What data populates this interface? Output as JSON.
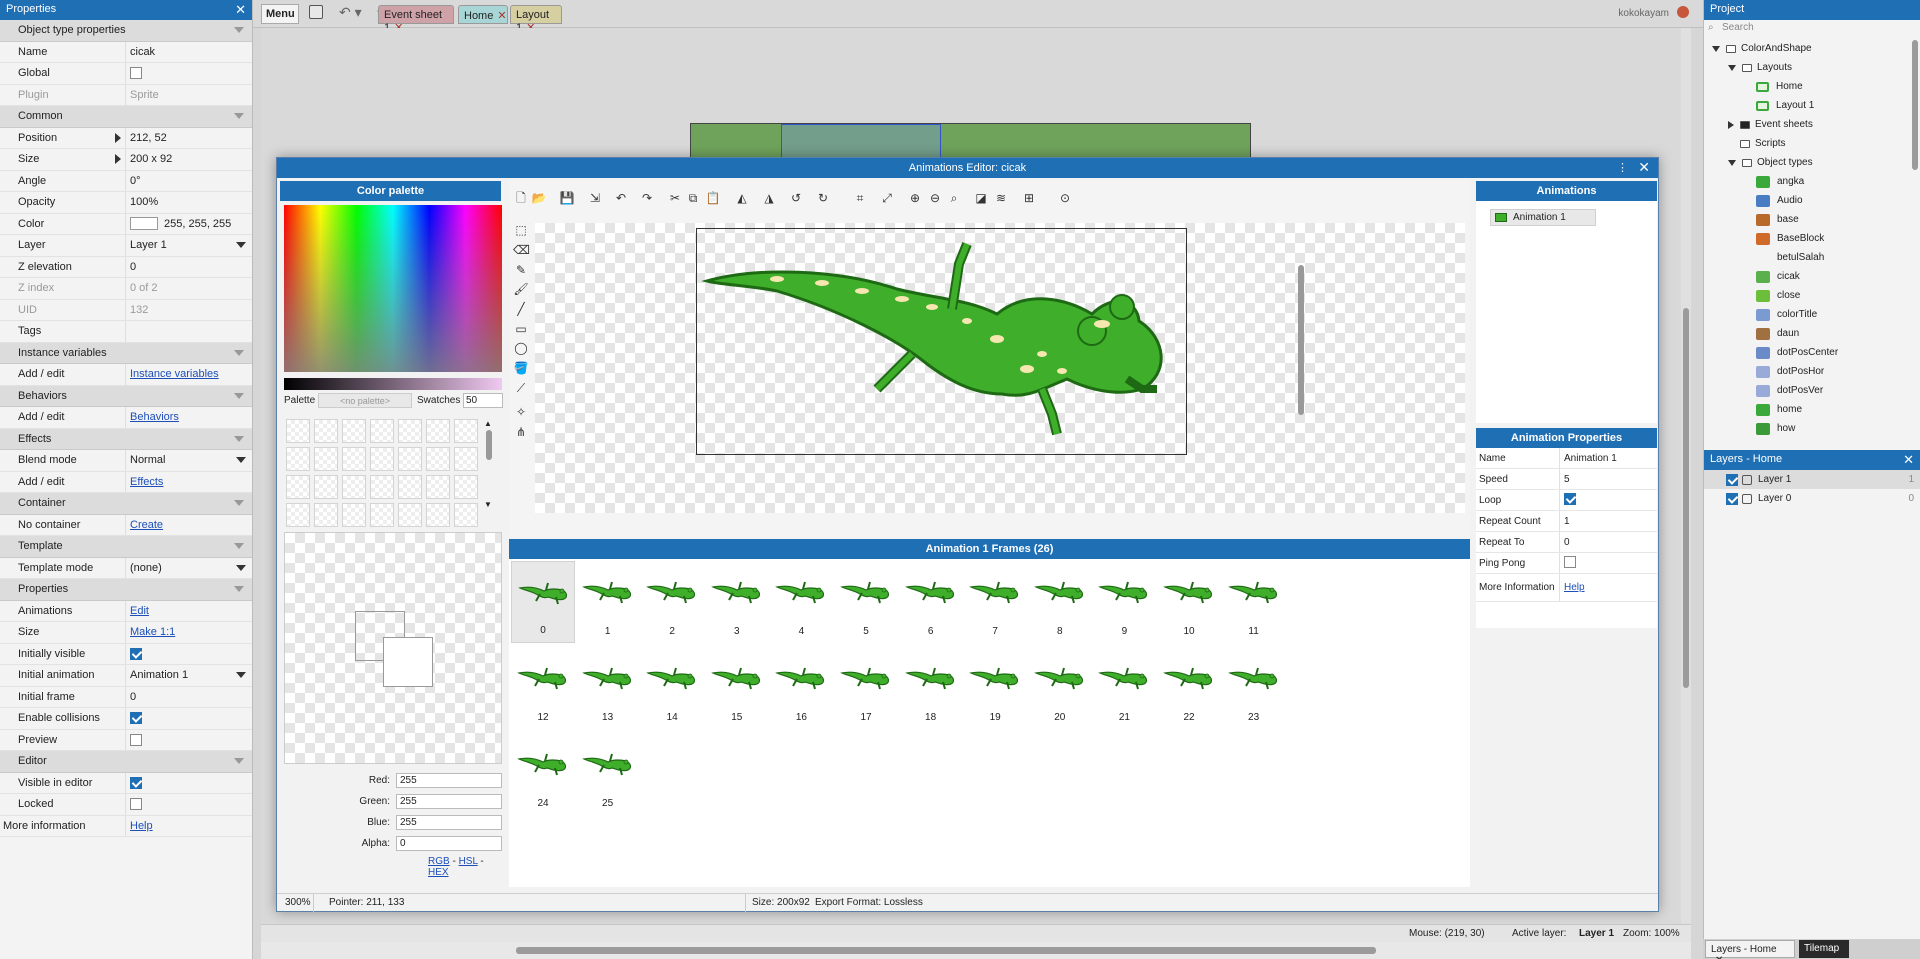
{
  "properties": {
    "title": "Properties",
    "rows": [
      {
        "type": "section",
        "k": "Object type properties"
      },
      {
        "k": "Name",
        "v": "cicak"
      },
      {
        "k": "Global",
        "cb": false
      },
      {
        "k": "Plugin",
        "v": "Sprite",
        "dis": true
      },
      {
        "type": "section",
        "k": "Common"
      },
      {
        "k": "Position",
        "v": "212, 52",
        "tri": true
      },
      {
        "k": "Size",
        "v": "200 x 92",
        "tri": true
      },
      {
        "k": "Angle",
        "v": "0°"
      },
      {
        "k": "Opacity",
        "v": "100%"
      },
      {
        "k": "Color",
        "v": "255, 255, 255",
        "swatch": true
      },
      {
        "k": "Layer",
        "v": "Layer 1",
        "dd": true
      },
      {
        "k": "Z elevation",
        "v": "0"
      },
      {
        "k": "Z index",
        "v": "0 of 2",
        "dis": true
      },
      {
        "k": "UID",
        "v": "132",
        "dis": true
      },
      {
        "k": "Tags",
        "v": ""
      },
      {
        "type": "section",
        "k": "Instance variables"
      },
      {
        "k": "Add / edit",
        "link": "Instance variables"
      },
      {
        "type": "section",
        "k": "Behaviors"
      },
      {
        "k": "Add / edit",
        "link": "Behaviors"
      },
      {
        "type": "section",
        "k": "Effects"
      },
      {
        "k": "Blend mode",
        "v": "Normal",
        "dd": true
      },
      {
        "k": "Add / edit",
        "link": "Effects"
      },
      {
        "type": "section",
        "k": "Container"
      },
      {
        "k": "No container",
        "link": "Create"
      },
      {
        "type": "section",
        "k": "Template"
      },
      {
        "k": "Template mode",
        "v": "(none)",
        "dd": true
      },
      {
        "type": "section",
        "k": "Properties"
      },
      {
        "k": "Animations",
        "link": "Edit"
      },
      {
        "k": "Size",
        "link": "Make 1:1"
      },
      {
        "k": "Initially visible",
        "cb": true
      },
      {
        "k": "Initial animation",
        "v": "Animation 1",
        "dd": true
      },
      {
        "k": "Initial frame",
        "v": "0"
      },
      {
        "k": "Enable collisions",
        "cb": true
      },
      {
        "k": "Preview",
        "cb": false
      },
      {
        "type": "section",
        "k": "Editor"
      },
      {
        "k": "Visible in editor",
        "cb": true
      },
      {
        "k": "Locked",
        "cb": false
      },
      {
        "k": "More information",
        "link": "Help",
        "noindent": true
      }
    ]
  },
  "topbar": {
    "menu": "Menu",
    "user": "kokokayam",
    "tabs": [
      {
        "label": "Event sheet 1",
        "color": "#cfa2a8"
      },
      {
        "label": "Home",
        "color": "#a8d6d6"
      },
      {
        "label": "Layout 1",
        "color": "#d6cfa2"
      }
    ]
  },
  "statusbar": {
    "mouse": "Mouse: (219, 30)",
    "active_layer_label": "Active layer:",
    "active_layer": "Layer 1",
    "zoom": "Zoom: 100%"
  },
  "project": {
    "title": "Project",
    "search_placeholder": "Search",
    "items": [
      {
        "label": "ColorAndShape",
        "kind": "folder",
        "level": 0,
        "tw": "down"
      },
      {
        "label": "Layouts",
        "kind": "folder",
        "level": 1,
        "tw": "down"
      },
      {
        "label": "Home",
        "kind": "layout",
        "level": 2
      },
      {
        "label": "Layout 1",
        "kind": "layout",
        "level": 2
      },
      {
        "label": "Event sheets",
        "kind": "folder-fill",
        "level": 1,
        "tw": "right"
      },
      {
        "label": "Scripts",
        "kind": "folder",
        "level": 1
      },
      {
        "label": "Object types",
        "kind": "folder",
        "level": 1,
        "tw": "down"
      },
      {
        "label": "angka",
        "kind": "obj",
        "color": "#3aa83a",
        "level": 2
      },
      {
        "label": "Audio",
        "kind": "obj",
        "color": "#4a7cc4",
        "level": 2
      },
      {
        "label": "base",
        "kind": "obj",
        "color": "#b86a2a",
        "level": 2
      },
      {
        "label": "BaseBlock",
        "kind": "obj",
        "color": "#d06a2a",
        "level": 2
      },
      {
        "label": "betulSalah",
        "kind": "obj",
        "color": "transparent",
        "level": 2
      },
      {
        "label": "cicak",
        "kind": "obj",
        "color": "#5ab04a",
        "level": 2
      },
      {
        "label": "close",
        "kind": "obj",
        "color": "#6cbf3a",
        "level": 2
      },
      {
        "label": "colorTitle",
        "kind": "obj",
        "color": "#7a9ad0",
        "level": 2
      },
      {
        "label": "daun",
        "kind": "obj",
        "color": "#a07040",
        "level": 2
      },
      {
        "label": "dotPosCenter",
        "kind": "obj",
        "color": "#6a8ac8",
        "level": 2
      },
      {
        "label": "dotPosHor",
        "kind": "obj",
        "color": "#9aaad8",
        "level": 2
      },
      {
        "label": "dotPosVer",
        "kind": "obj",
        "color": "#9aaad8",
        "level": 2
      },
      {
        "label": "home",
        "kind": "obj",
        "color": "#3aa83a",
        "level": 2
      },
      {
        "label": "how",
        "kind": "obj",
        "color": "#3a9a3a",
        "level": 2
      }
    ]
  },
  "layers": {
    "title": "Layers - Home",
    "items": [
      {
        "label": "Layer 1",
        "num": "1"
      },
      {
        "label": "Layer 0",
        "num": "0"
      }
    ]
  },
  "bottom_tabs": [
    "Layers - Home",
    "Tilemap"
  ],
  "dialog": {
    "title": "Animations Editor: cicak",
    "palette": {
      "title": "Color palette",
      "palette_label": "Palette",
      "palette_value": "<no palette>",
      "swatches_label": "Swatches",
      "swatches_value": "50",
      "red_label": "Red:",
      "red": "255",
      "green_label": "Green:",
      "green": "255",
      "blue_label": "Blue:",
      "blue": "255",
      "alpha_label": "Alpha:",
      "alpha": "0",
      "modes": [
        "RGB",
        "HSL",
        "HEX"
      ]
    },
    "frames_title": "Animation 1 Frames (26)",
    "frames": [
      "0",
      "1",
      "2",
      "3",
      "4",
      "5",
      "6",
      "7",
      "8",
      "9",
      "10",
      "11",
      "12",
      "13",
      "14",
      "15",
      "16",
      "17",
      "18",
      "19",
      "20",
      "21",
      "22",
      "23",
      "24",
      "25"
    ],
    "animations_title": "Animations",
    "animations": [
      "Animation 1"
    ],
    "anim_props_title": "Animation Properties",
    "anim_props": [
      {
        "k": "Name",
        "v": "Animation 1"
      },
      {
        "k": "Speed",
        "v": "5"
      },
      {
        "k": "Loop",
        "cb": true
      },
      {
        "k": "Repeat Count",
        "v": "1"
      },
      {
        "k": "Repeat To",
        "v": "0"
      },
      {
        "k": "Ping Pong",
        "cb": false
      },
      {
        "k": "More Information",
        "link": "Help"
      }
    ],
    "status": {
      "zoom": "300%",
      "pointer": "Pointer: 211, 133",
      "size": "Size: 200x92",
      "export": "Export Format: Lossless"
    }
  },
  "colors": {
    "accent": "#1f6fb5",
    "lizard": "#3fae2a",
    "lizard_dark": "#1e6a14"
  }
}
